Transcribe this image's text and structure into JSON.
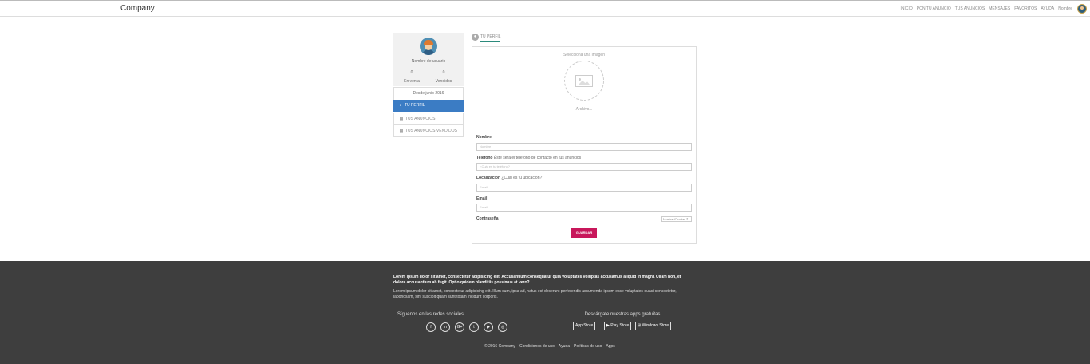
{
  "header": {
    "brand": "Company",
    "nav": [
      "INICIO",
      "PON TU ANUNCIO",
      "TUS ANUNCIOS",
      "MENSAJES",
      "FAVORITOS",
      "AYUDA",
      "Nombre"
    ]
  },
  "sidebar": {
    "username": "Nombre de usuario",
    "stats": [
      {
        "value": "0",
        "label": "En venta"
      },
      {
        "value": "0",
        "label": "Vendidos"
      }
    ],
    "since": "Desde junio 2016",
    "menu": [
      {
        "label": "TU PERFIL",
        "icon": "user-icon",
        "active": true
      },
      {
        "label": "TUS ANUNCIOS",
        "icon": "grid-icon",
        "active": false
      },
      {
        "label": "TUS ANUNCIOS VENDIDOS",
        "icon": "grid-icon",
        "active": false
      }
    ]
  },
  "tab": {
    "label": "TU PERFIL"
  },
  "form": {
    "image_select": "Selecciona una imagen",
    "image_file": "Archivo...",
    "fields": {
      "name": {
        "label": "Nombre",
        "hint": "",
        "placeholder": "Nombre"
      },
      "phone": {
        "label": "Teléfono",
        "hint": "Éste será el teléfono de contacto en tus anuncios",
        "placeholder": "¿Cuál es tu teléfono?"
      },
      "location": {
        "label": "Localización",
        "hint": "¿Cuál es tu ubicación?",
        "placeholder": "Email"
      },
      "email": {
        "label": "Email",
        "hint": "",
        "placeholder": "Email"
      },
      "password": {
        "label": "Contraseña",
        "select": "Mostrar/Ocultar ⇕"
      }
    },
    "save": "GUARDAR"
  },
  "footer": {
    "p1": "Lorem ipsum dolor sit amet, consectetur adipisicing elit. Accusantium consequatur quia voluptates voluptas accusamus aliquid in magni. Ullam non, et dolore accusantium ab fugit. Optio quidem blanditiis possimus at vero?",
    "p2": "Lorem ipsum dolor sit amet, consectetur adipisicing elit. Illum cum, ipsa ad, natus est deserunt perferendis assumenda ipsum esse voluptates quasi consectetur, laboriosam, sint suscipit quam sunt totam incidunt corporis.",
    "social_title": "Síguenos en las redes sociales",
    "apps_title": "Descárgate nuestras apps gratuitas",
    "social": [
      {
        "icon": "facebook-icon",
        "glyph": "f"
      },
      {
        "icon": "linkedin-icon",
        "glyph": "in"
      },
      {
        "icon": "googleplus-icon",
        "glyph": "G+"
      },
      {
        "icon": "twitter-icon",
        "glyph": "t"
      },
      {
        "icon": "youtube-icon",
        "glyph": "▶"
      },
      {
        "icon": "instagram-icon",
        "glyph": "◎"
      }
    ],
    "stores": [
      "App Store",
      "Play Store",
      "Windows Store"
    ],
    "links": [
      "© 2016 Company",
      "Condiciones de uso",
      "Ayuda",
      "Políticas de uso",
      "Apps"
    ]
  },
  "colors": {
    "active_menu": "#3b7cc4",
    "save_button": "#c8175b",
    "footer_bg": "#3e3e3e",
    "tab_underline": "#2c8a7c"
  }
}
